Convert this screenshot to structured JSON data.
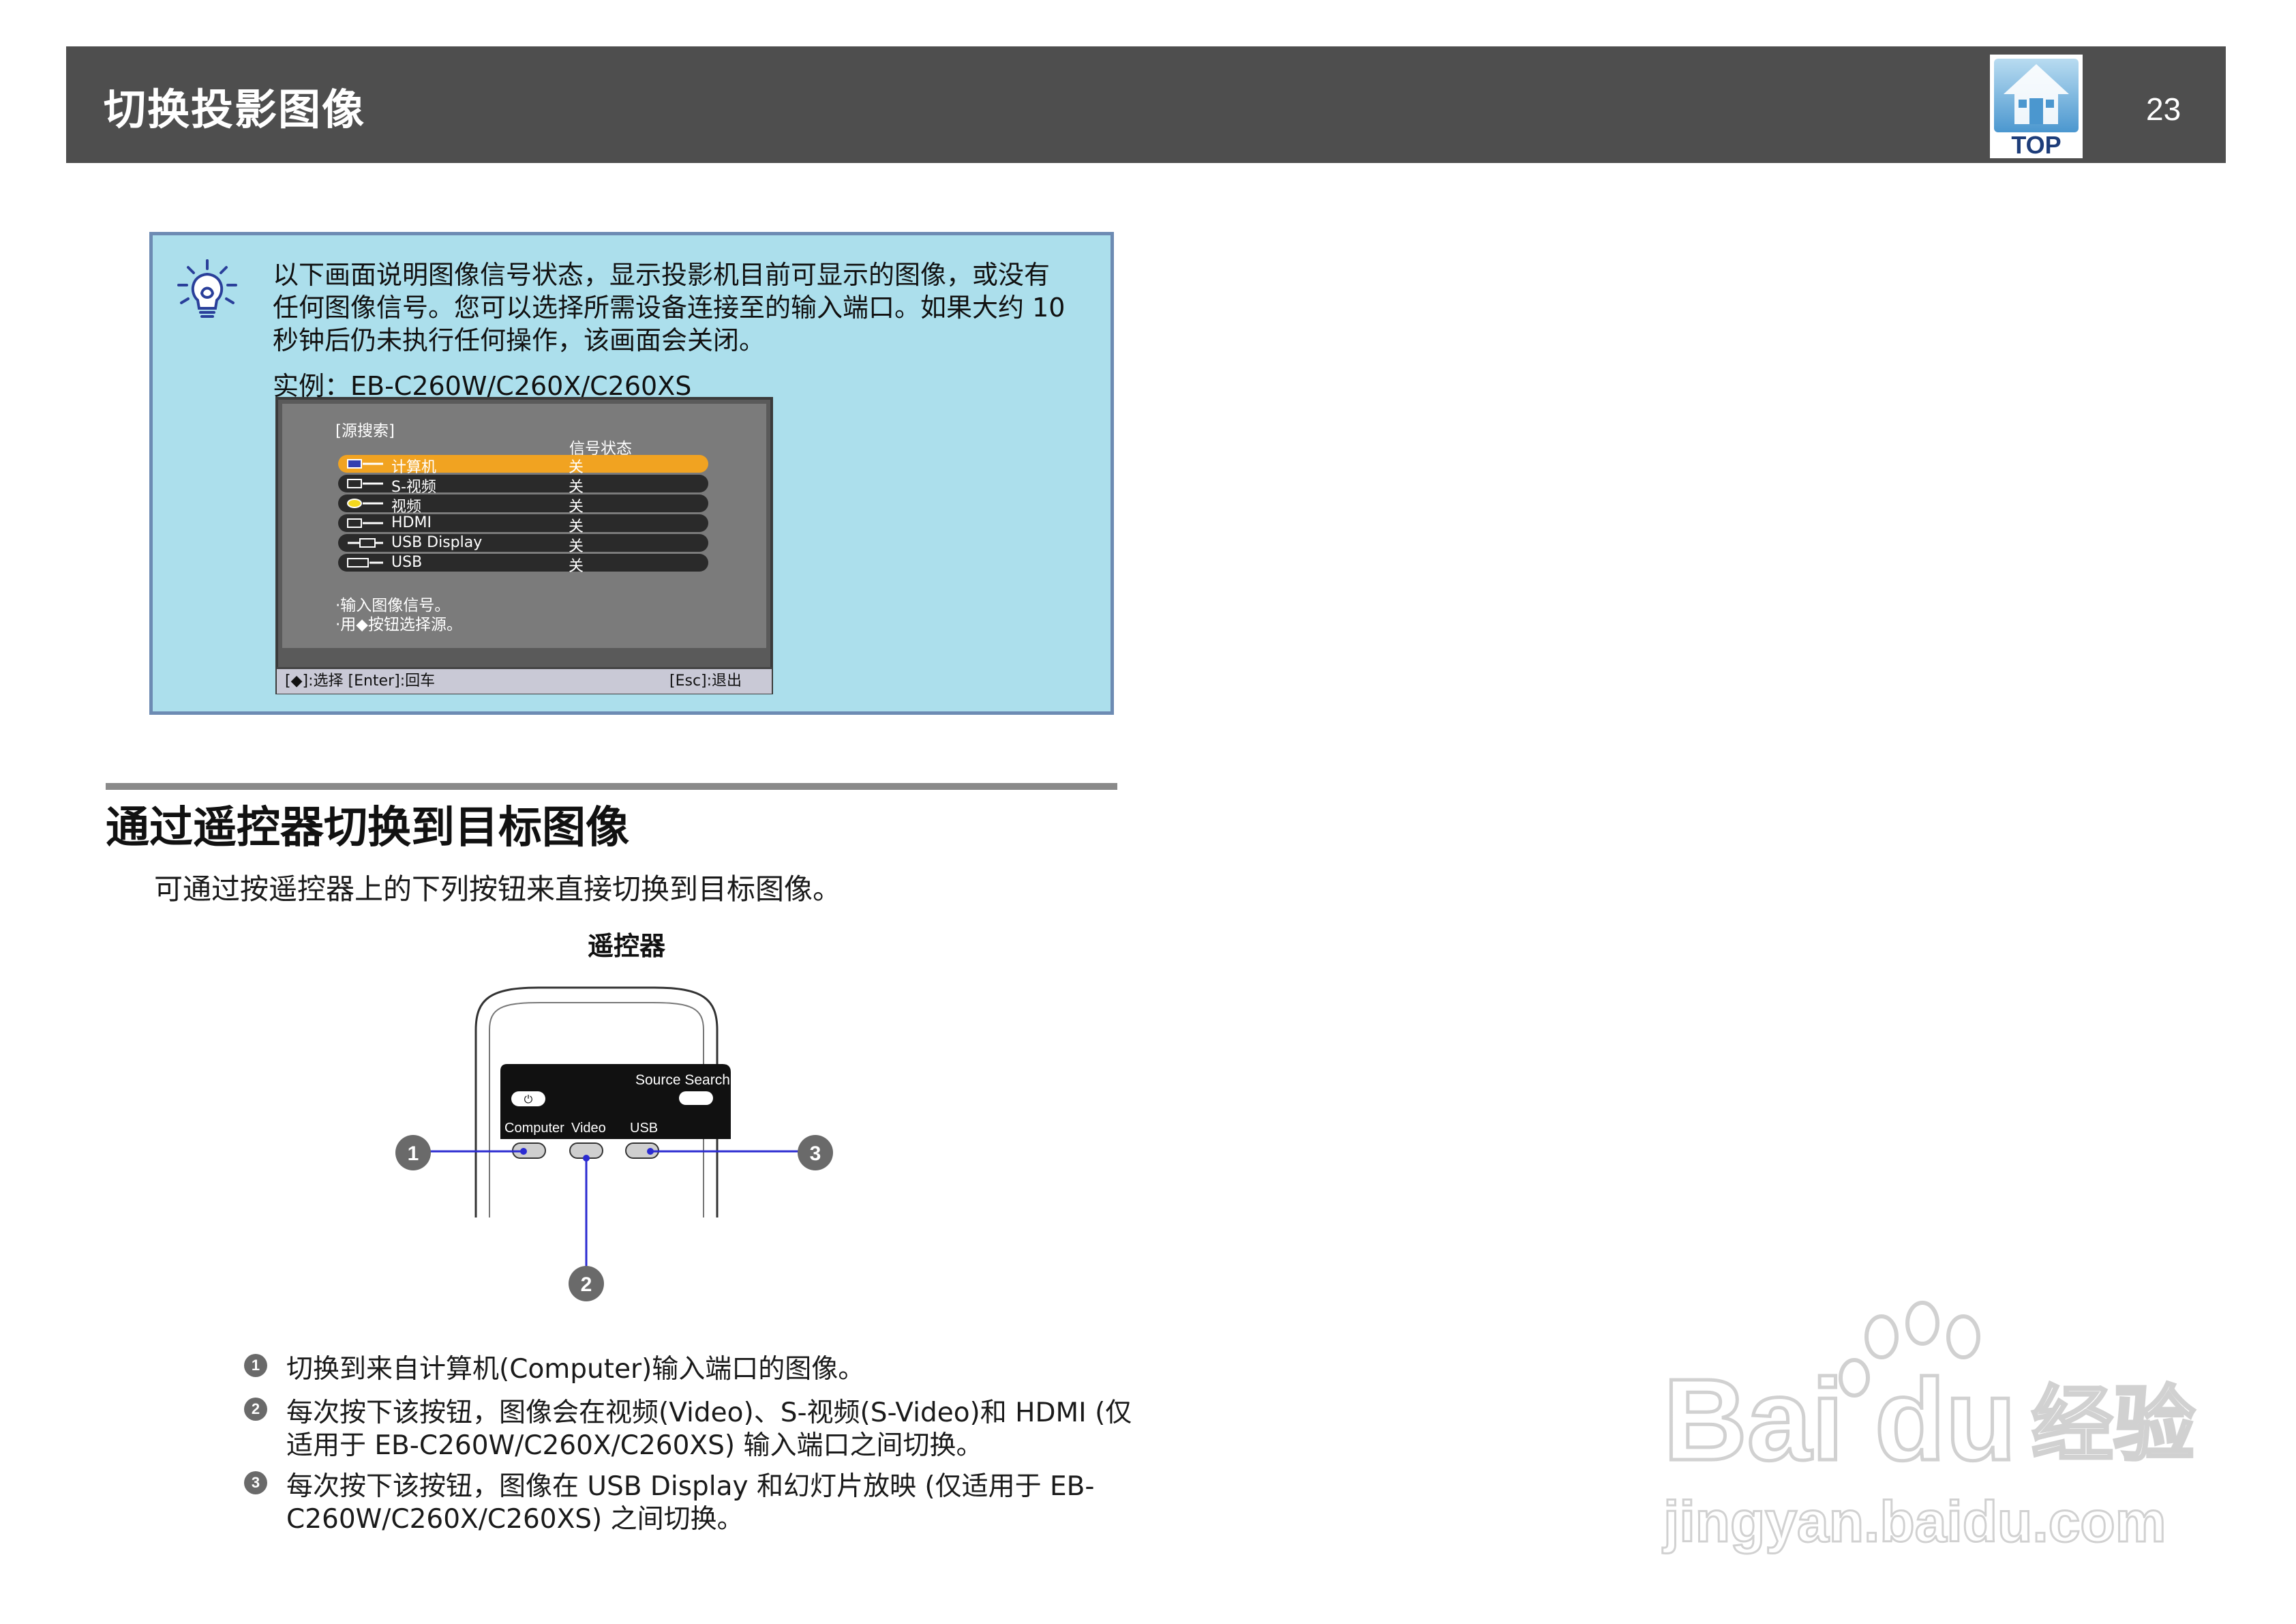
{
  "header": {
    "title": "切换投影图像",
    "page_number": "23",
    "top_button_label": "TOP"
  },
  "tip": {
    "line1": "以下画面说明图像信号状态，显示投影机目前可显示的图像，或没有",
    "line2": "任何图像信号。您可以选择所需设备连接至的输入端口。如果大约 10",
    "line3": "秒钟后仍未执行任何操作，该画面会关闭。",
    "example": "实例：EB-C260W/C260X/C260XS",
    "screen": {
      "title": "[源搜索]",
      "column_header": "信号状态",
      "rows": [
        {
          "label": "计算机",
          "status": "关",
          "selected": true
        },
        {
          "label": "S-视频",
          "status": "关",
          "selected": false
        },
        {
          "label": "视频",
          "status": "关",
          "selected": false
        },
        {
          "label": "HDMI",
          "status": "关",
          "selected": false
        },
        {
          "label": "USB Display",
          "status": "关",
          "selected": false
        },
        {
          "label": "USB",
          "status": "关",
          "selected": false
        }
      ],
      "hint1": "·输入图像信号。",
      "hint2": "·用◆按钮选择源。",
      "footer_left": "[◆]:选择 [Enter]:回车",
      "footer_right": "[Esc]:退出"
    }
  },
  "section": {
    "title": "通过遥控器切换到目标图像",
    "intro": "可通过按遥控器上的下列按钮来直接切换到目标图像。",
    "remote_caption": "遥控器"
  },
  "remote": {
    "source_search_label": "Source Search",
    "computer_label": "Computer",
    "video_label": "Video",
    "usb_label": "USB",
    "callouts": [
      "1",
      "2",
      "3"
    ]
  },
  "list": {
    "item1": "切换到来自计算机(Computer)输入端口的图像。",
    "item2_line1": "每次按下该按钮，图像会在视频(Video)、S-视频(S-Video)和 HDMI (仅",
    "item2_line2": "适用于 EB-C260W/C260X/C260XS) 输入端口之间切换。",
    "item3_line1": "每次按下该按钮，图像在 USB Display 和幻灯片放映 (仅适用于 EB-",
    "item3_line2": "C260W/C260X/C260XS) 之间切换。"
  },
  "watermark": {
    "brand": "Bai du 经验",
    "url": "jingyan.baidu.com"
  },
  "colors": {
    "header_bg": "#4e4e4e",
    "tip_bg": "#acdfec",
    "tip_border": "#6d8bb3",
    "selected_row": "#f1a321",
    "callout_line": "#2b2bd1"
  }
}
